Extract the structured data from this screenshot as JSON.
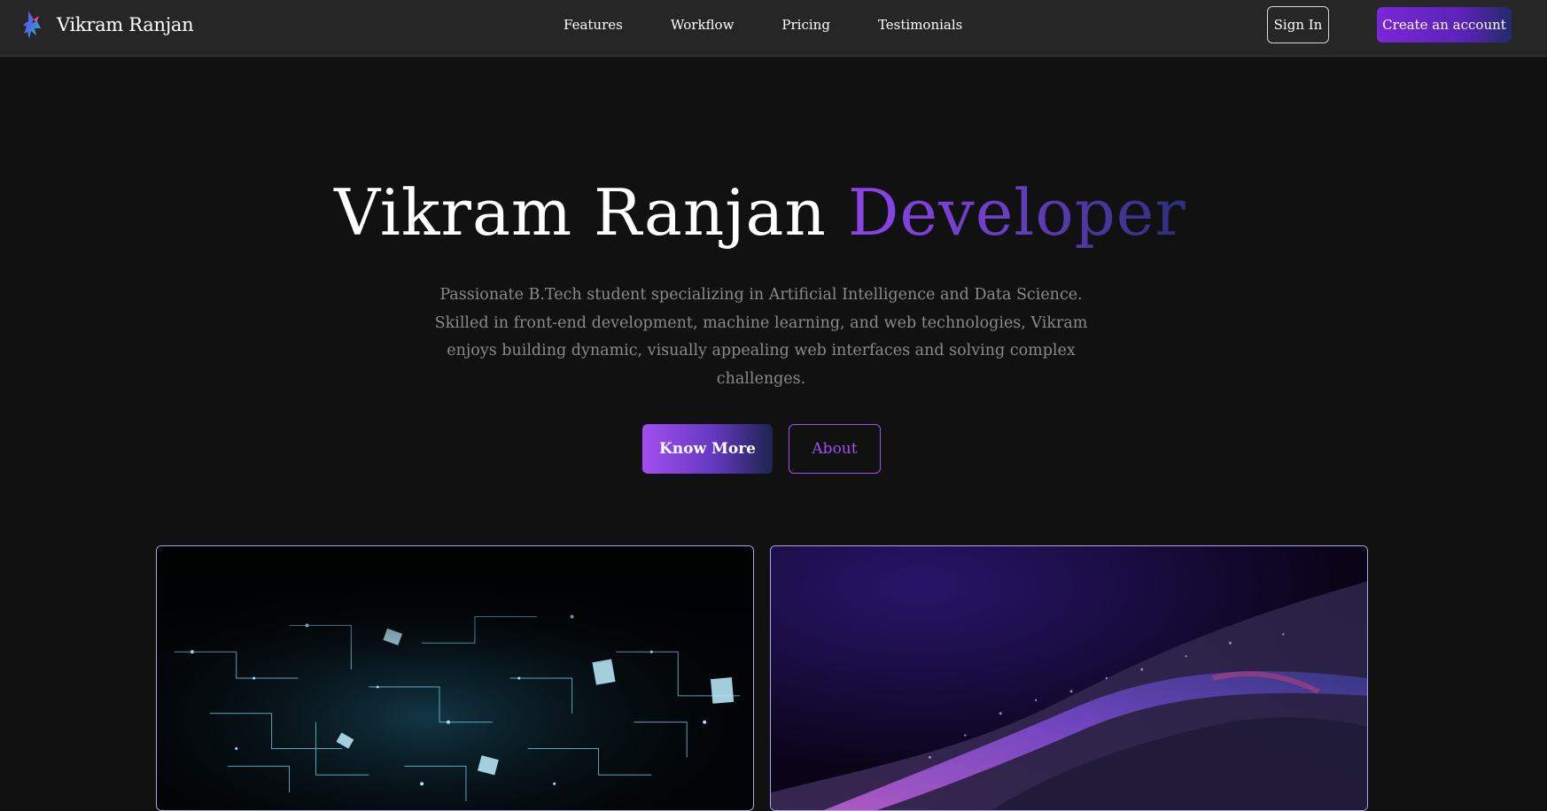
{
  "navbar": {
    "brand_name": "Vikram Ranjan",
    "brand_logo_icon": "phoenix-logo-icon",
    "links": [
      "Features",
      "Workflow",
      "Pricing",
      "Testimonials"
    ],
    "sign_in_label": "Sign In",
    "create_account_label": "Create an account"
  },
  "hero": {
    "title_main": "Vikram Ranjan",
    "title_accent": "Developer",
    "description": "Passionate B.Tech student specializing in Artificial Intelligence and Data Science. Skilled in front-end development, machine learning, and web technologies, Vikram enjoys building dynamic, visually appealing web interfaces and solving complex challenges.",
    "primary_button": "Know More",
    "secondary_button": "About"
  },
  "colors": {
    "background": "#111111",
    "navbar": "#262626",
    "accent_purple": "#8e45e8",
    "accent_navy": "#2c2f7a",
    "description_text": "#8a8a8a"
  },
  "images": {
    "left": "cyan-digital-network-image",
    "right": "purple-particle-wave-image"
  }
}
